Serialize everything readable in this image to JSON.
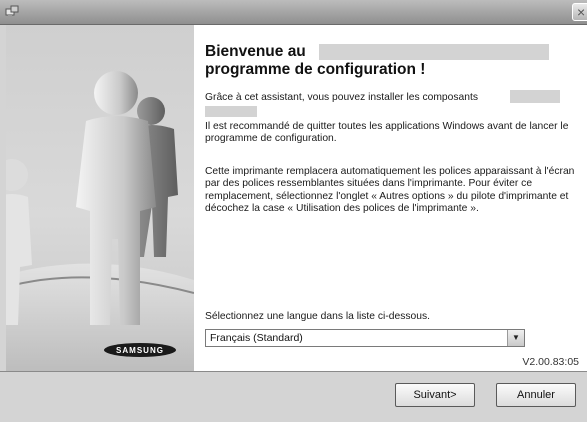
{
  "window": {
    "close_glyph": "×"
  },
  "welcome": {
    "title_line1": "Bienvenue au",
    "title_line2": "programme de configuration !"
  },
  "intro": {
    "text": "Grâce à cet assistant, vous pouvez installer les composants"
  },
  "recommend": {
    "text": "Il est recommandé de quitter toutes les applications Windows avant de lancer le programme de configuration."
  },
  "fonts_note": {
    "text": "Cette imprimante remplacera automatiquement les polices apparaissant à l'écran par des polices ressemblantes situées dans l'imprimante. Pour éviter ce remplacement, sélectionnez l'onglet « Autres options » du pilote d'imprimante et décochez la case « Utilisation des polices de l'imprimante »."
  },
  "language": {
    "label": "Sélectionnez une langue dans la liste ci-dessous.",
    "selected": "Français (Standard)"
  },
  "version": "V2.00.83:05",
  "brand": {
    "logo_text": "SAMSUNG"
  },
  "buttons": {
    "next": "Suivant>",
    "cancel": "Annuler"
  },
  "colors": {
    "panel": "#ffffff",
    "frame": "#d4d4d4",
    "redaction": "#d3d3d3"
  },
  "icons": {
    "app": "installer-icon",
    "close": "close-icon",
    "dropdown": "chevron-down-icon"
  }
}
